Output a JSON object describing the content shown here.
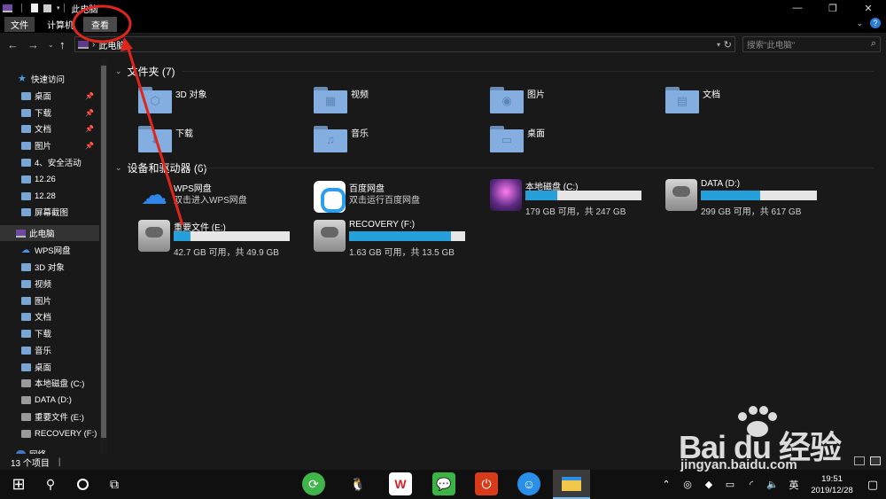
{
  "window": {
    "title": "此电脑",
    "controls": [
      "minimize-icon",
      "restore-icon",
      "close-icon"
    ]
  },
  "ribbon": {
    "tabs": [
      {
        "label": "文件"
      },
      {
        "label": "计算机"
      },
      {
        "label": "查看"
      }
    ]
  },
  "address": {
    "path": "此电脑",
    "search_placeholder": "搜索\"此电脑\""
  },
  "nav": {
    "items": [
      {
        "label": "快速访问",
        "icon": "star-icon",
        "pinned": false
      },
      {
        "label": "桌面",
        "icon": "folder-icon",
        "pinned": true
      },
      {
        "label": "下载",
        "icon": "folder-icon",
        "pinned": true
      },
      {
        "label": "文档",
        "icon": "folder-icon",
        "pinned": true
      },
      {
        "label": "图片",
        "icon": "folder-icon",
        "pinned": true
      },
      {
        "label": "4、安全活动",
        "icon": "folder-icon",
        "pinned": false
      },
      {
        "label": "12.26",
        "icon": "folder-icon",
        "pinned": false
      },
      {
        "label": "12.28",
        "icon": "folder-icon",
        "pinned": false
      },
      {
        "label": "屏幕截图",
        "icon": "folder-icon",
        "pinned": false
      },
      {
        "label": "此电脑",
        "icon": "computer-icon",
        "selected": true
      },
      {
        "label": "WPS网盘",
        "icon": "cloud-icon"
      },
      {
        "label": "3D 对象",
        "icon": "folder-icon"
      },
      {
        "label": "视频",
        "icon": "folder-icon"
      },
      {
        "label": "图片",
        "icon": "folder-icon"
      },
      {
        "label": "文档",
        "icon": "folder-icon"
      },
      {
        "label": "下载",
        "icon": "folder-icon"
      },
      {
        "label": "音乐",
        "icon": "folder-icon"
      },
      {
        "label": "桌面",
        "icon": "folder-icon"
      },
      {
        "label": "本地磁盘 (C:)",
        "icon": "drive-icon"
      },
      {
        "label": "DATA (D:)",
        "icon": "drive-icon"
      },
      {
        "label": "重要文件 (E:)",
        "icon": "drive-icon"
      },
      {
        "label": "RECOVERY (F:)",
        "icon": "drive-icon"
      },
      {
        "label": "网络",
        "icon": "network-icon"
      }
    ]
  },
  "folders": {
    "header": "文件夹 (7)",
    "items": [
      {
        "label": "3D 对象",
        "icon": "3d-objects-folder-icon"
      },
      {
        "label": "视频",
        "icon": "videos-folder-icon"
      },
      {
        "label": "图片",
        "icon": "pictures-folder-icon"
      },
      {
        "label": "文档",
        "icon": "documents-folder-icon"
      },
      {
        "label": "下载",
        "icon": "downloads-folder-icon"
      },
      {
        "label": "音乐",
        "icon": "music-folder-icon"
      },
      {
        "label": "桌面",
        "icon": "desktop-folder-icon"
      }
    ]
  },
  "devices": {
    "header": "设备和驱动器 (6)",
    "items": [
      {
        "name": "WPS网盘",
        "sub": "双击进入WPS网盘",
        "icon": "wps-cloud-icon"
      },
      {
        "name": "百度网盘",
        "sub": "双击运行百度网盘",
        "icon": "baidu-netdisk-icon"
      },
      {
        "name": "本地磁盘 (C:)",
        "sub": "179 GB 可用，共 247 GB",
        "icon": "windows-drive-icon",
        "used_fraction": 0.275
      },
      {
        "name": "DATA (D:)",
        "sub": "299 GB 可用，共 617 GB",
        "icon": "hard-drive-icon",
        "used_fraction": 0.515
      },
      {
        "name": "重要文件 (E:)",
        "sub": "42.7 GB 可用，共 49.9 GB",
        "icon": "hard-drive-icon",
        "used_fraction": 0.144
      },
      {
        "name": "RECOVERY (F:)",
        "sub": "1.63 GB 可用，共 13.5 GB",
        "icon": "hard-drive-icon",
        "used_fraction": 0.879
      }
    ]
  },
  "status": {
    "count": "13 个项目",
    "sep": "|"
  },
  "taskbar": {
    "tray_lang": "英",
    "time": "19:51",
    "date": "2019/12/28"
  },
  "watermark": {
    "brand": "Bai du 经验",
    "url": "jingyan.baidu.com"
  },
  "colors": {
    "accent": "#26a0da",
    "annotation": "#e0261c",
    "background": "#191919"
  }
}
